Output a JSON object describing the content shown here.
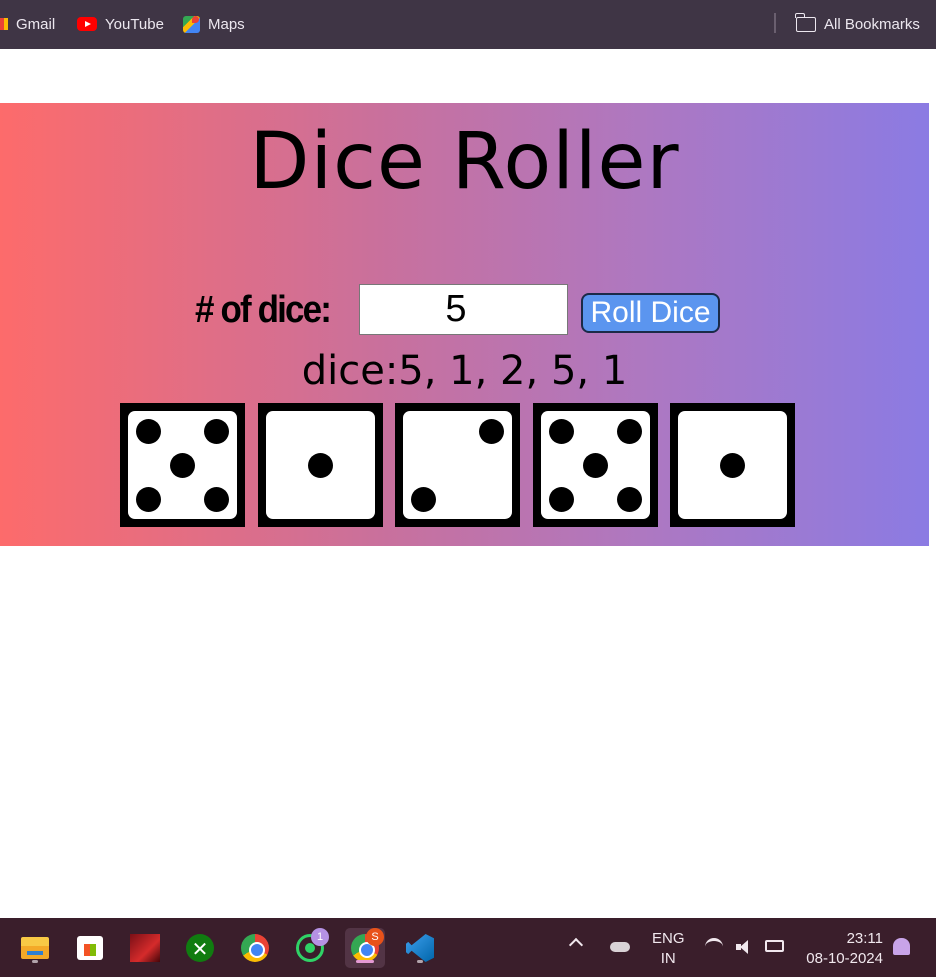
{
  "bookmarks": {
    "items": [
      {
        "label": "Gmail",
        "icon": "gmail-icon"
      },
      {
        "label": "YouTube",
        "icon": "youtube-icon"
      },
      {
        "label": "Maps",
        "icon": "maps-icon"
      }
    ],
    "all_bookmarks_label": "All Bookmarks"
  },
  "app": {
    "title": "Dice Roller",
    "count_label": "# of dice:",
    "count_value": "5",
    "roll_button_label": "Roll Dice",
    "result_text": "dice:5, 1, 2, 5, 1",
    "dice": [
      5,
      1,
      2,
      5,
      1
    ],
    "colors": {
      "gradient_start": "#fd6b6b",
      "gradient_end": "#8b7be3",
      "button": "#5b95ef"
    }
  },
  "taskbar": {
    "apps": [
      {
        "name": "file-explorer-icon",
        "active": false
      },
      {
        "name": "microsoft-store-icon",
        "active": false
      },
      {
        "name": "game-icon",
        "active": false
      },
      {
        "name": "xbox-icon",
        "active": false
      },
      {
        "name": "chrome-icon",
        "active": false
      },
      {
        "name": "whatsapp-icon",
        "active": false,
        "badge": "1"
      },
      {
        "name": "chrome-profile-icon",
        "active": true,
        "badge": "S"
      },
      {
        "name": "vscode-icon",
        "active": false
      }
    ],
    "language_line1": "ENG",
    "language_line2": "IN",
    "time": "23:11",
    "date": "08-10-2024"
  }
}
